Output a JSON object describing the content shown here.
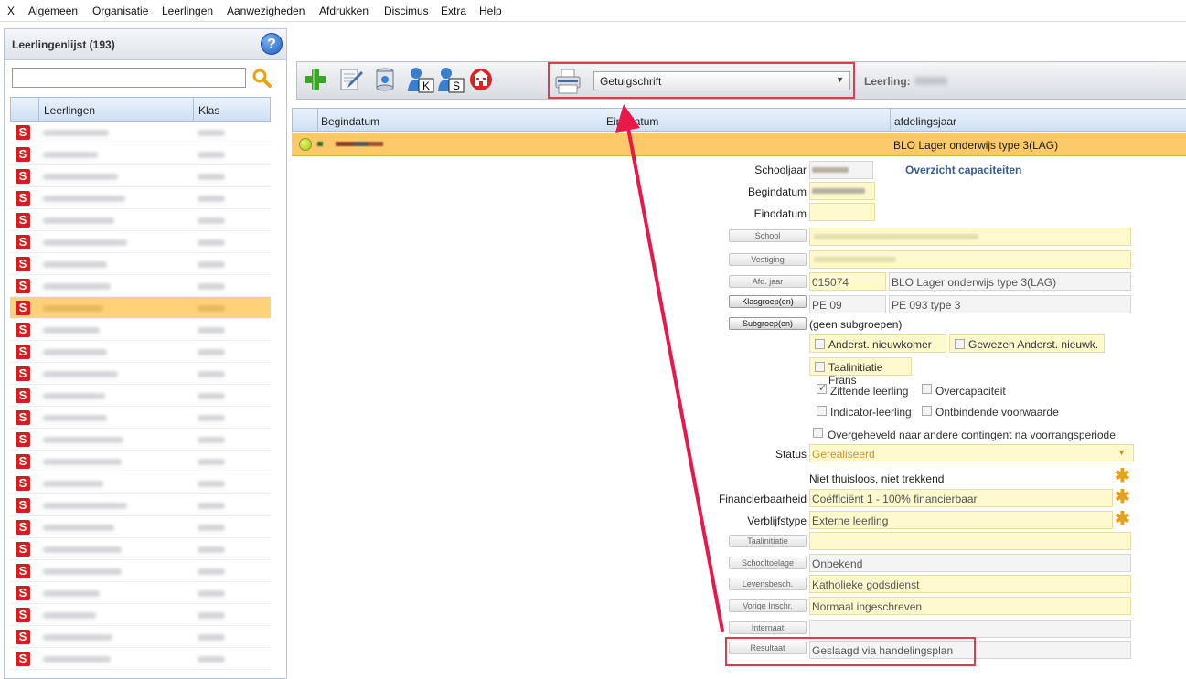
{
  "menu": [
    "X",
    "Algemeen",
    "Organisatie",
    "Leerlingen",
    "Aanwezigheden",
    "Afdrukken",
    "Discimus",
    "Extra",
    "Help"
  ],
  "left_panel": {
    "title": "Leerlingenlijst (193)",
    "search_placeholder": "",
    "columns": [
      "Leerlingen",
      "Klas"
    ],
    "row_badge": "S",
    "selected_index": 8
  },
  "toolbar": {
    "document_select": "Getuigschrift",
    "leerling_label": "Leerling:",
    "icon_letters": [
      "K",
      "S"
    ]
  },
  "grid": {
    "columns": [
      "Begindatum",
      "Einddatum",
      "afdelingsjaar"
    ],
    "row_afdelingsjaar": "BLO Lager onderwijs type 3(LAG)"
  },
  "form": {
    "section_title": "Overzicht capaciteiten",
    "labels": {
      "schooljaar": "Schooljaar",
      "begindatum": "Begindatum",
      "einddatum": "Einddatum",
      "status": "Status",
      "financierbaarheid": "Financierbaarheid",
      "verblijfstype": "Verblijfstype"
    },
    "buttons": {
      "school": "School",
      "vestiging": "Vestiging",
      "afd_jaar": "Afd. jaar",
      "klasgroep": "Klasgroep(en)",
      "subgroep": "Subgroep(en)",
      "taalinitiatie": "Taalinitiatie",
      "schooltoelage": "Schooltoelage",
      "levensbesch": "Levensbesch.",
      "vorige_inschr": "Vorige Inschr.",
      "internaat": "Internaat",
      "resultaat": "Resultaat"
    },
    "values": {
      "afd_code": "015074",
      "afd_name": "BLO Lager onderwijs type 3(LAG)",
      "klasgroep_code": "PE 09",
      "klasgroep_name": "PE 093 type 3",
      "subgroep": "(geen subgroepen)",
      "status": "Gerealiseerd",
      "thuisloos": "Niet thuisloos, niet trekkend",
      "financierbaarheid": "Coëfficiënt 1 - 100% financierbaar",
      "verblijfstype": "Externe leerling",
      "schooltoelage": "Onbekend",
      "levensbesch": "Katholieke godsdienst",
      "vorige_inschr": "Normaal ingeschreven",
      "resultaat": "Geslaagd via handelingsplan"
    },
    "checkboxes": {
      "anderst_nieuwkomer": "Anderst. nieuwkomer",
      "gewezen_anderst": "Gewezen Anderst. nieuwk.",
      "taalinitiatie_frans": "Taalinitiatie Frans",
      "zittende_leerling": "Zittende leerling",
      "overcapaciteit": "Overcapaciteit",
      "indicator_leerling": "Indicator-leerling",
      "ontbindende_voorwaarde": "Ontbindende voorwaarde",
      "overgeheveld": "Overgeheveld naar andere contingent na voorrangsperiode."
    }
  },
  "colors": {
    "selected_row": "#fcc96a",
    "annotation": "#e23b4e",
    "star": "#e6a11b",
    "field_yellow": "#fdf9cc"
  }
}
